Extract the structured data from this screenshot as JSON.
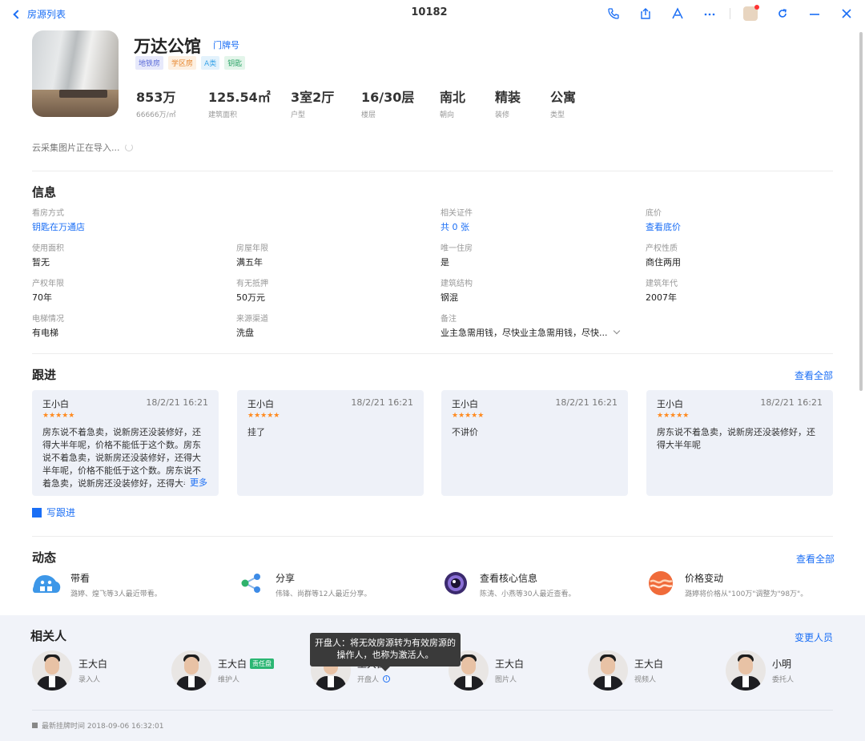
{
  "topbar": {
    "back_label": "房源列表",
    "title": "10182",
    "icons": [
      "phone-icon",
      "share-icon",
      "a-icon",
      "more-icon",
      "user-avatar",
      "refresh-icon",
      "minimize-icon",
      "close-icon"
    ]
  },
  "header": {
    "name": "万达公馆",
    "doorplate_link": "门牌号",
    "tags": [
      {
        "label": "地铁房",
        "color": "#5b6bd8",
        "bg": "#e7e9fb"
      },
      {
        "label": "学区房",
        "color": "#e6842b",
        "bg": "#fdf0e2"
      },
      {
        "label": "A类",
        "color": "#3aa4e8",
        "bg": "#e3f2fc"
      },
      {
        "label": "钥匙",
        "color": "#2fa66a",
        "bg": "#e3f5ea"
      }
    ],
    "stats": [
      {
        "value": "853万",
        "label": "66666万/㎡"
      },
      {
        "value": "125.54㎡",
        "label": "建筑面积"
      },
      {
        "value": "3室2厅",
        "label": "户型"
      },
      {
        "value": "16/30层",
        "label": "楼层"
      },
      {
        "value": "南北",
        "label": "朝向"
      },
      {
        "value": "精装",
        "label": "装修"
      },
      {
        "value": "公寓",
        "label": "类型"
      }
    ],
    "cloud_note": "云采集图片正在导入..."
  },
  "info": {
    "title": "信息",
    "fields": [
      {
        "label": "看房方式",
        "value": "钥匙在万通店",
        "link": true
      },
      {
        "label": "相关证件",
        "value": "共 0 张",
        "link": true
      },
      {
        "label": "底价",
        "value": "查看底价",
        "link": true
      },
      {
        "label": "使用面积",
        "value": "暂无"
      },
      {
        "label": "房屋年限",
        "value": "满五年"
      },
      {
        "label": "唯一住房",
        "value": "是"
      },
      {
        "label": "产权性质",
        "value": "商住两用"
      },
      {
        "label": "产权年限",
        "value": "70年"
      },
      {
        "label": "有无抵押",
        "value": "50万元"
      },
      {
        "label": "建筑结构",
        "value": "钢混"
      },
      {
        "label": "建筑年代",
        "value": "2007年"
      },
      {
        "label": "电梯情况",
        "value": "有电梯"
      },
      {
        "label": "来源渠道",
        "value": "洗盘"
      },
      {
        "label": "备注",
        "value": "业主急需用钱，尽快业主急需用钱，尽快..."
      }
    ]
  },
  "followup": {
    "title": "跟进",
    "view_all": "查看全部",
    "write_label": "写跟进",
    "more_label": "更多",
    "cards": [
      {
        "author": "王小白",
        "time": "18/2/21 16:21",
        "stars": "★★★★★",
        "text": "房东说不着急卖，说新房还没装修好，还得大半年呢，价格不能低于这个数。房东说不着急卖，说新房还没装修好，还得大半年呢，价格不能低于这个数。房东说不着急卖，说新房还没装修好，还得大半年呢"
      },
      {
        "author": "王小白",
        "time": "18/2/21 16:21",
        "stars": "★★★★★",
        "text": "挂了"
      },
      {
        "author": "王小白",
        "time": "18/2/21 16:21",
        "stars": "★★★★★",
        "text": "不讲价"
      },
      {
        "author": "王小白",
        "time": "18/2/21 16:21",
        "stars": "★★★★★",
        "text": "房东说不着急卖，说新房还没装修好，还得大半年呢"
      }
    ]
  },
  "activity": {
    "title": "动态",
    "view_all": "查看全部",
    "items": [
      {
        "icon": "people-icon",
        "title": "带看",
        "desc": "潞婷、煌飞等3人最近带看。"
      },
      {
        "icon": "share-nodes-icon",
        "title": "分享",
        "desc": "伟锋、尚群等12人最近分享。"
      },
      {
        "icon": "eye-core-icon",
        "title": "查看核心信息",
        "desc": "陈涛、小燕等30人最近查看。"
      },
      {
        "icon": "price-wave-icon",
        "title": "价格变动",
        "desc": "潞婷将价格从\"100万\"调整为\"98万\"。"
      }
    ]
  },
  "related": {
    "title": "相关人",
    "change_label": "变更人员",
    "tooltip": "开盘人：将无效房源转为有效房源的操作人，也称为激活人。",
    "people": [
      {
        "name": "王大白",
        "role": "录入人"
      },
      {
        "name": "王大白",
        "role": "维护人",
        "badge": "责任盘"
      },
      {
        "name": "王大白",
        "role": "开盘人",
        "info": true
      },
      {
        "name": "王大白",
        "role": "图片人"
      },
      {
        "name": "王大白",
        "role": "视频人"
      },
      {
        "name": "小明",
        "role": "委托人"
      }
    ]
  },
  "footer": {
    "text": "最新挂牌时间 2018-09-06 16:32:01"
  }
}
